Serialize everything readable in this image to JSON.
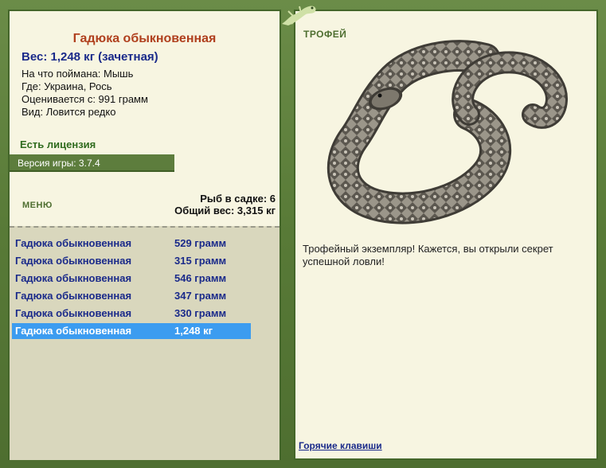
{
  "fish": {
    "title": "Гадюка обыкновенная",
    "weight": "Вес: 1,248 кг (зачетная)",
    "caught_on": "На что поймана: Мышь",
    "location": "Где: Украина, Рось",
    "valued_from": "Оценивается с: 991 грамм",
    "kind": "Вид: Ловится редко"
  },
  "license": "Есть лицензия",
  "version": "Версия игры: 3.7.4",
  "menu_label": "МЕНЮ",
  "keepnet": {
    "count": "Рыб в садке: 6",
    "total_weight": "Общий вес: 3,315 кг"
  },
  "catches": [
    {
      "name": "Гадюка обыкновенная",
      "weight": "529 грамм"
    },
    {
      "name": "Гадюка обыкновенная",
      "weight": "315 грамм"
    },
    {
      "name": "Гадюка обыкновенная",
      "weight": "546 грамм"
    },
    {
      "name": "Гадюка обыкновенная",
      "weight": "347 грамм"
    },
    {
      "name": "Гадюка обыкновенная",
      "weight": "330 грамм"
    },
    {
      "name": "Гадюка обыкновенная",
      "weight": "1,248 кг"
    }
  ],
  "selected_catch_index": 5,
  "trophy": {
    "label": "ТРОФЕЙ",
    "message": "Трофейный экземпляр! Кажется, вы открыли секрет успешной ловли!"
  },
  "hotkeys_link": "Горячие клавиши",
  "icons": {
    "corner": "gecko-icon",
    "trophy_image": "viper-snake-image"
  }
}
